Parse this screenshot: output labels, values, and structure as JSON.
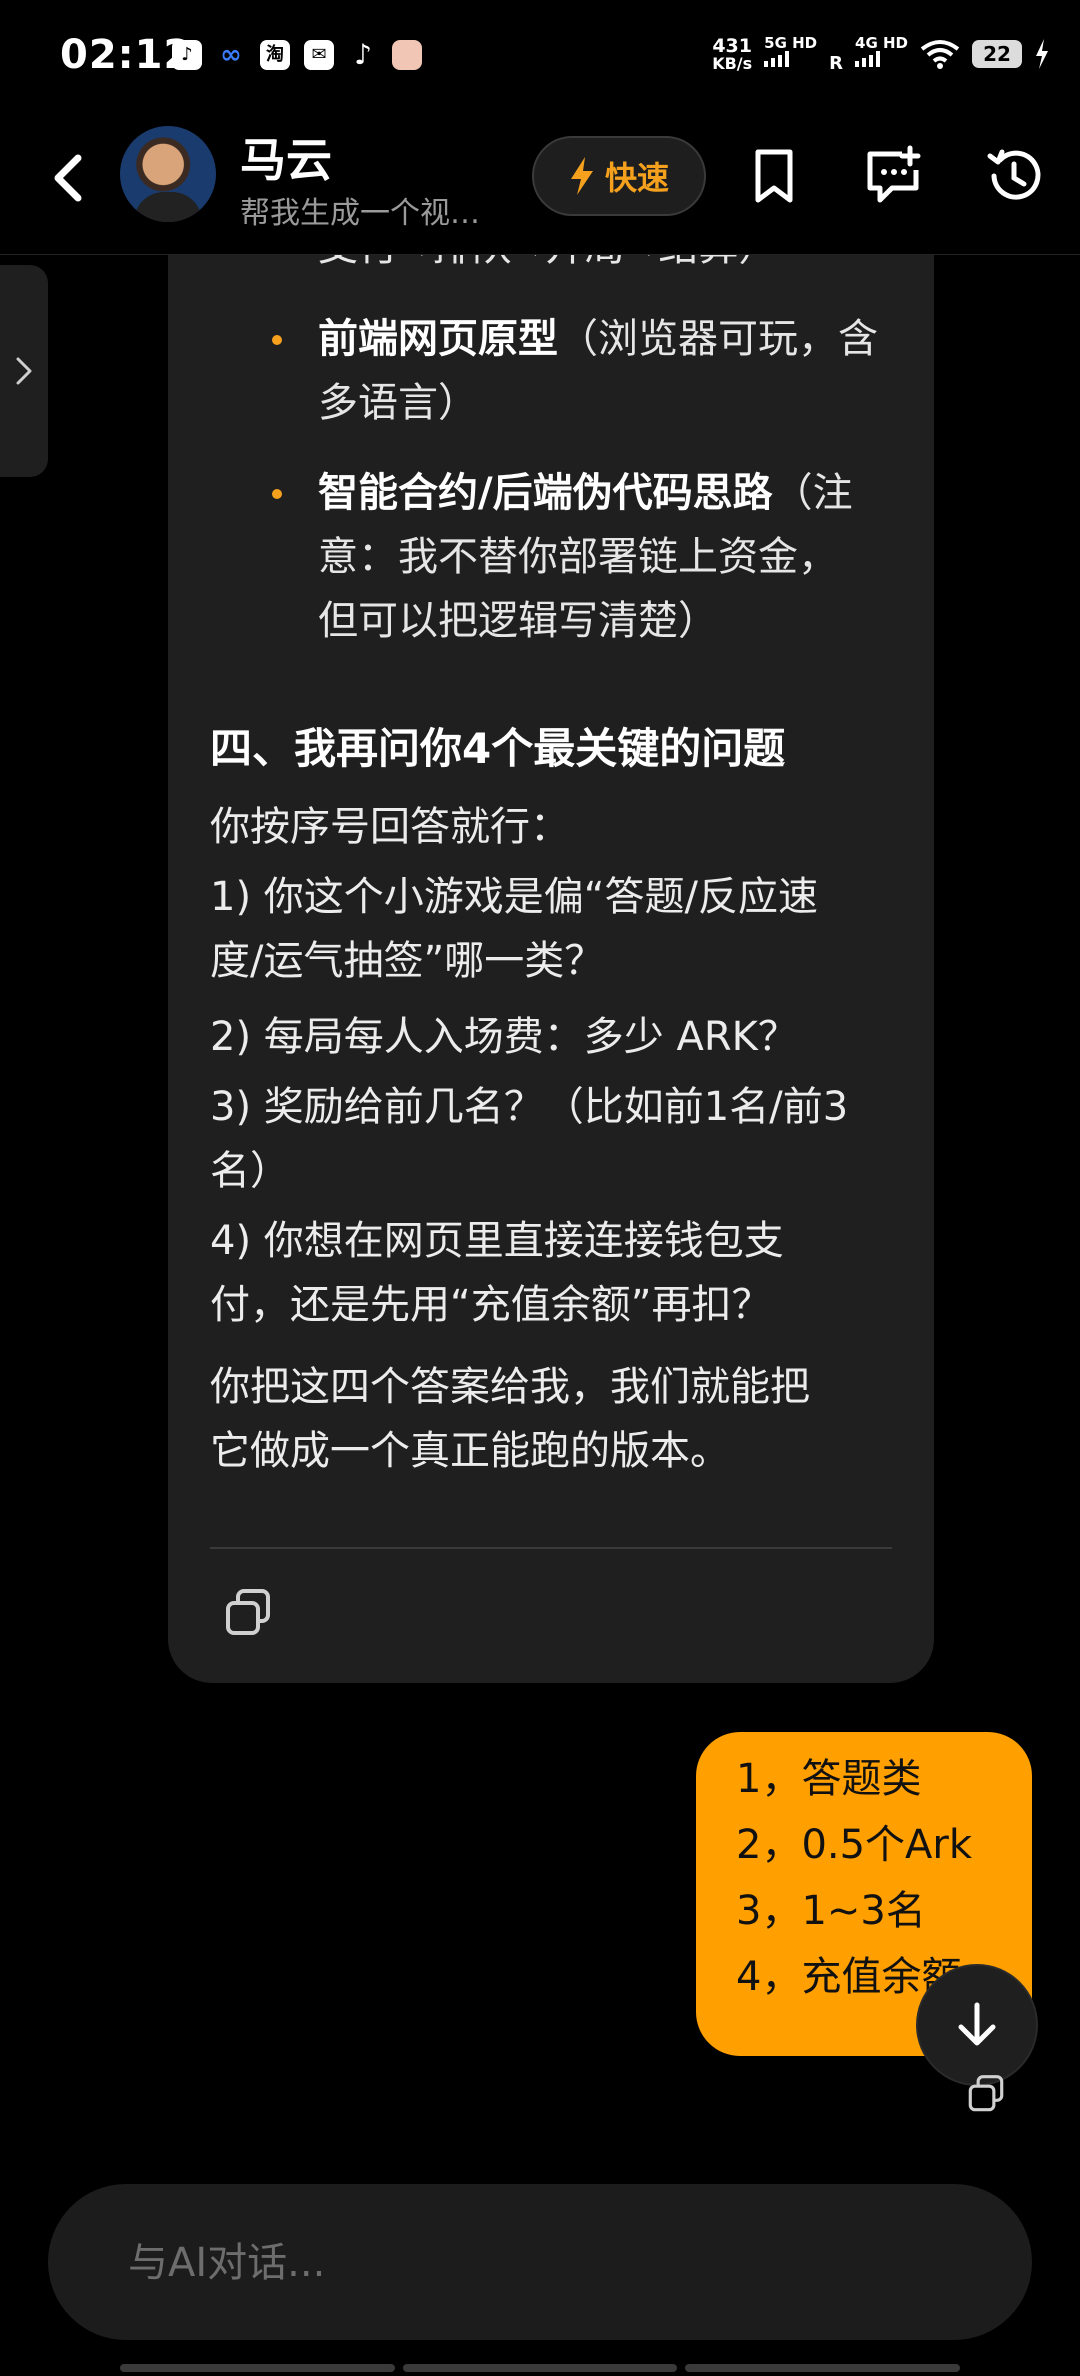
{
  "status_bar": {
    "time": "02:12",
    "app_icons": [
      "tiktok-icon",
      "link-icon",
      "taobao-icon",
      "mail-icon",
      "tiktok-icon",
      "avatar-icon"
    ],
    "taobao_glyph": "淘",
    "speed_value": "431",
    "speed_unit": "KB/s",
    "net1": "5G HD",
    "net2": "4G HD",
    "roaming": "R",
    "battery": "22"
  },
  "header": {
    "title": "马云",
    "subtitle": "帮我生成一个视…",
    "fast_label": "快速"
  },
  "ai_message": {
    "clipped_top": "支付→排队→开局→结算）",
    "bullets": [
      {
        "bold": "前端网页原型",
        "line1_rest": "（浏览器可玩，含",
        "line2": "多语言）"
      },
      {
        "bold": "智能合约/后端伪代码思路",
        "line1_rest": "（注",
        "line2": "意：我不替你部署链上资金，",
        "line3": "但可以把逻辑写清楚）"
      }
    ],
    "heading": "四、我再问你4个最关键的问题",
    "intro": "你按序号回答就行：",
    "q1_a": "1) 你这个小游戏是偏“答题/反应速",
    "q1_b": "度/运气抽签”哪一类？",
    "q2": "2) 每局每人入场费：多少 ARK？",
    "q3_a": "3) 奖励给前几名？（比如前1名/前3",
    "q3_b": "名）",
    "q4_a": "4) 你想在网页里直接连接钱包支",
    "q4_b": "付，还是先用“充值余额”再扣？",
    "closing_a": "你把这四个答案给我，我们就能把",
    "closing_b": "它做成一个真正能跑的版本。"
  },
  "user_message": {
    "lines": [
      "1，答题类",
      "2，0.5个Ark",
      "3，1~3名",
      "4，充值余额"
    ]
  },
  "input": {
    "placeholder": "与AI对话..."
  },
  "colors": {
    "accent": "#f5a11d",
    "user_bubble": "#ff9f00",
    "ai_bubble": "#1f1f1f",
    "background": "#000000"
  }
}
